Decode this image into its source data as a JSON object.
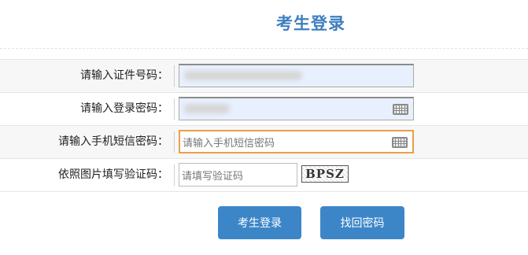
{
  "page_title": "考生登录",
  "fields": [
    {
      "label": "请输入证件号码：",
      "value": "",
      "masked": true
    },
    {
      "label": "请输入登录密码：",
      "value": "",
      "masked": true
    },
    {
      "label": "请输入手机短信密码：",
      "placeholder": "请输入手机短信密码"
    },
    {
      "label": "依照图片填写验证码：",
      "placeholder": "请填写验证码",
      "captcha_text": "BPSZ"
    }
  ],
  "buttons": {
    "login": "考生登录",
    "recover_password": "找回密码"
  },
  "colors": {
    "title": "#3f7fbe",
    "button": "#3c86c8",
    "focus_border": "#e8a04a",
    "autofill_bg": "#e8f0fe"
  },
  "icons": {
    "keyboard": "keyboard-icon"
  }
}
